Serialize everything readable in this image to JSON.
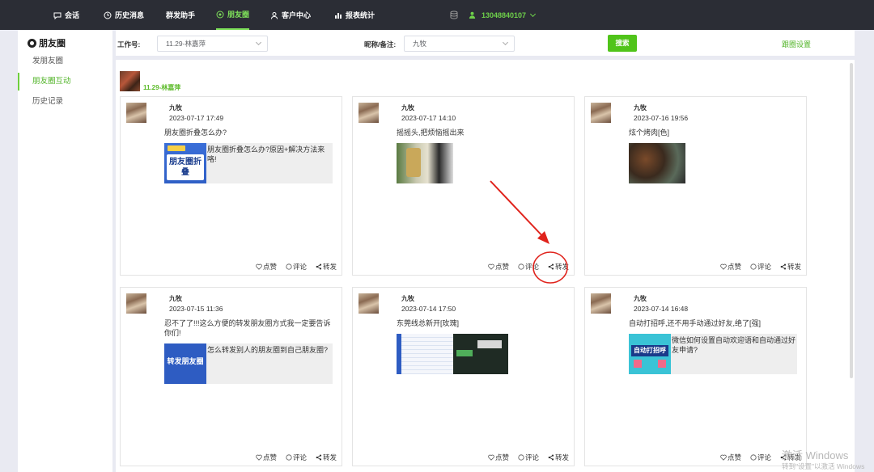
{
  "nav": {
    "items": [
      {
        "label": "会话",
        "icon": "chat-icon"
      },
      {
        "label": "历史消息",
        "icon": "clock-icon"
      },
      {
        "label": "群发助手",
        "icon": ""
      },
      {
        "label": "朋友圈",
        "icon": "moments-icon"
      },
      {
        "label": "客户中心",
        "icon": "user-icon"
      },
      {
        "label": "报表统计",
        "icon": "bar-chart-icon"
      }
    ],
    "active": "朋友圈",
    "account_phone": "13048840107"
  },
  "sidebar": {
    "title": "朋友圈",
    "items": [
      {
        "label": "发朋友圈"
      },
      {
        "label": "朋友圈互动"
      },
      {
        "label": "历史记录"
      }
    ],
    "active": "朋友圈互动"
  },
  "filter": {
    "work_id_label": "工作号:",
    "work_id_value": "11.29-林嘉萍",
    "nickname_label": "昵称/备注:",
    "nickname_value": "九牧",
    "search_label": "搜索",
    "settings_label": "跟圈设置"
  },
  "account": {
    "name": "11.29-林嘉萍"
  },
  "actions": {
    "like": "点赞",
    "comment": "评论",
    "forward": "转发"
  },
  "posts": [
    {
      "name": "九牧",
      "time": "2023-07-17 17:49",
      "text": "朋友圈折叠怎么办?",
      "link_text": "朋友圈折叠怎么办?原因+解决方法来咯!",
      "thumb_text": "朋友圈折叠"
    },
    {
      "name": "九牧",
      "time": "2023-07-17 14:10",
      "text": "摇摇头,把烦恼摇出来"
    },
    {
      "name": "九牧",
      "time": "2023-07-16 19:56",
      "text": "炫个烤肉[色]"
    },
    {
      "name": "九牧",
      "time": "2023-07-15 11:36",
      "text": "忍不了了!!!这么方便的转发朋友圈方式我一定要告诉你们!",
      "link_text": "怎么转发别人的朋友圈到自己朋友圈?",
      "thumb_text": "转发朋友圈"
    },
    {
      "name": "九牧",
      "time": "2023-07-14 17:50",
      "text": "东莞线总新开[玫瑰]"
    },
    {
      "name": "九牧",
      "time": "2023-07-14 16:48",
      "text": "自动打招呼,还不用手动通过好友,绝了[强]",
      "link_text": "微信如何设置自动欢迎语和自动通过好友申请?",
      "thumb_text": "自动打招呼"
    }
  ],
  "watermark": {
    "line1": "激活 Windows",
    "line2": "转到\"设置\"以激活 Windows"
  },
  "colors": {
    "nav_bg": "#2b2d35",
    "accent": "#50c41a",
    "annotation": "#e0231c"
  }
}
